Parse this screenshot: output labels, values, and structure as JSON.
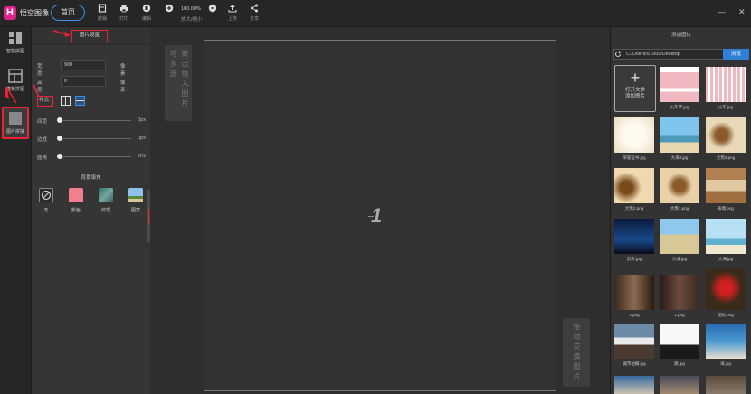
{
  "app": {
    "title": "悟空图像",
    "home": "首页"
  },
  "toolbar": [
    {
      "label": "撤销",
      "icon": "undo-icon"
    },
    {
      "label": "打印",
      "icon": "print-icon"
    },
    {
      "label": "编辑",
      "icon": "edit-icon"
    },
    {
      "label": "放大/缩小",
      "icon": "zoom-in-icon"
    },
    {
      "label": "上传",
      "icon": "upload-icon"
    },
    {
      "label": "分享",
      "icon": "share-icon"
    }
  ],
  "zoom": {
    "value": "100.00%"
  },
  "window": {
    "minimize": "—",
    "close": "✕"
  },
  "sidebar": [
    {
      "label": "智能拼图"
    },
    {
      "label": "模板拼图"
    },
    {
      "label": "图片拼接"
    }
  ],
  "settings": {
    "tab": "图片设置",
    "width_label": "宽度",
    "width_value": "900",
    "width_unit": "像素",
    "height_label": "高度",
    "height_value": "0",
    "height_unit": "像素",
    "style_label": "样式:",
    "sliders": [
      {
        "label": "间距",
        "value": "0px"
      },
      {
        "label": "边框",
        "value": "0px"
      },
      {
        "label": "圆角",
        "value": "0%"
      }
    ],
    "bg_title": "背景填充",
    "bg_options": [
      {
        "label": "无"
      },
      {
        "label": "颜色"
      },
      {
        "label": "纹理"
      },
      {
        "label": "图案"
      }
    ],
    "collapse": "‹"
  },
  "canvas": {
    "hint_left": [
      "双",
      "击",
      "插",
      "入",
      "图",
      "片",
      "可",
      "多",
      "选"
    ],
    "hint_right": [
      "拖",
      "动",
      "交",
      "换",
      "图",
      "片"
    ],
    "page_number": "1"
  },
  "images": {
    "title": "添加图片",
    "path": "C:/Users/51955/Desktop",
    "browse": "浏览",
    "open_file": "打开文件",
    "add_image": "添加图片",
    "items": [
      {
        "name": "火车票.jpg"
      },
      {
        "name": "火车.jpg"
      },
      {
        "name": "荣誉证书.jpg"
      },
      {
        "name": "大海3.jpg"
      },
      {
        "name": "大熊3.png"
      },
      {
        "name": "大熊2.png"
      },
      {
        "name": "大熊1.png"
      },
      {
        "name": "表情.png"
      },
      {
        "name": "剪影.jpg"
      },
      {
        "name": "沙滩.jpg"
      },
      {
        "name": "大海.jpg"
      },
      {
        "name": "2.png"
      },
      {
        "name": "1.png"
      },
      {
        "name": "图标.png"
      },
      {
        "name": "城市拍摄.jpg"
      },
      {
        "name": "跳.jpg"
      },
      {
        "name": "海.jpg"
      }
    ]
  }
}
